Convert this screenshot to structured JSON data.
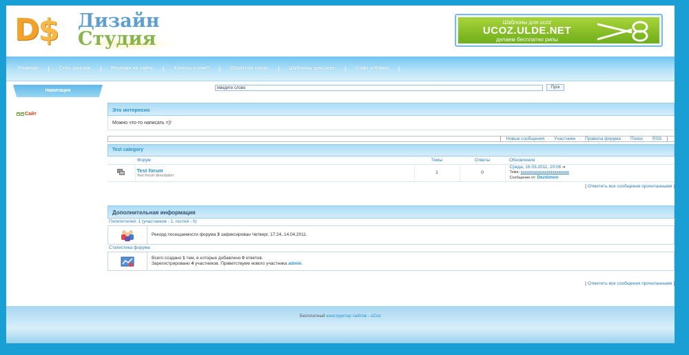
{
  "logo": {
    "ds": "D",
    "dollar": "$",
    "line1": "Дизайн",
    "line2": "Студия"
  },
  "banner": {
    "top": "Шаблоны для ucoz",
    "main": "UCOZ.ULDE.NET",
    "bottom": "делаем бесплатно рипы"
  },
  "nav": {
    "items": [
      "Главная",
      "Стол заказов",
      "Реклама на сайте",
      "Хочешь к нам?",
      "Обратная связь",
      "Шаблоны для ucoz",
      "Софт и Юмор"
    ],
    "sep": "|"
  },
  "sidebar": {
    "title": "Навигация",
    "item": "Сайт"
  },
  "search": {
    "placeholder": "Введите слово",
    "value": "Введите слово",
    "button": "Пуск"
  },
  "info": {
    "title": "Это интересно",
    "text": "Можно что-то написать =)!"
  },
  "toplinks": {
    "open": "[",
    "close": "]",
    "dot": "·",
    "items": [
      "Новые сообщения",
      "Участники",
      "Правила форума",
      "Поиск",
      "RSS"
    ]
  },
  "category": {
    "title": "Test category",
    "columns": {
      "forum": "Форум",
      "topics": "Темы",
      "replies": "Ответы",
      "updates": "Обновления"
    },
    "row": {
      "name": "Test forum",
      "desc": "Test forum description",
      "topics": "1",
      "replies": "0",
      "update_date": "Среда, 16.03.2011, 20:06",
      "update_arrow": "➔",
      "topic_label": "Тема:",
      "topic_value": "ааааааааааааааааааааааа",
      "msg_label": "Сообщение от:",
      "msg_author": "Dezdimon"
    }
  },
  "markread": {
    "open": "[",
    "text": "Отметить все сообщения прочитанными",
    "close": "]"
  },
  "extra": {
    "title": "Дополнительная информация",
    "visitors_label": "Посетителей:",
    "visitors_total": "1",
    "visitors_open": "(участников -",
    "visitors_users": "1",
    "visitors_mid": ", гостей -",
    "visitors_guests": "0",
    "visitors_close": ")",
    "record_pre": "Рекорд посещаемости форума",
    "record_num": "3",
    "record_post": "зафиксирован Четверг, 17:24, 14.04.2011.",
    "stats_label": "Статистика форума",
    "stats_l1_pre": "Всего создано",
    "stats_l1_topics": "1",
    "stats_l1_mid": "тем, в которые добавлено",
    "stats_l1_replies": "0",
    "stats_l1_post": "ответов.",
    "stats_l2_pre": "Зарегистрировано",
    "stats_l2_num": "4",
    "stats_l2_mid": "участников. Приветствуем нового участника",
    "stats_l2_user": "admin",
    "stats_l2_end": "."
  },
  "footer": {
    "text": "Бесплатный",
    "link": "конструктор сайтов - uCoz"
  },
  "colors": {
    "background": "#1a9fd4",
    "accent": "#2a8fc9",
    "nav": "#6ec3ef"
  }
}
